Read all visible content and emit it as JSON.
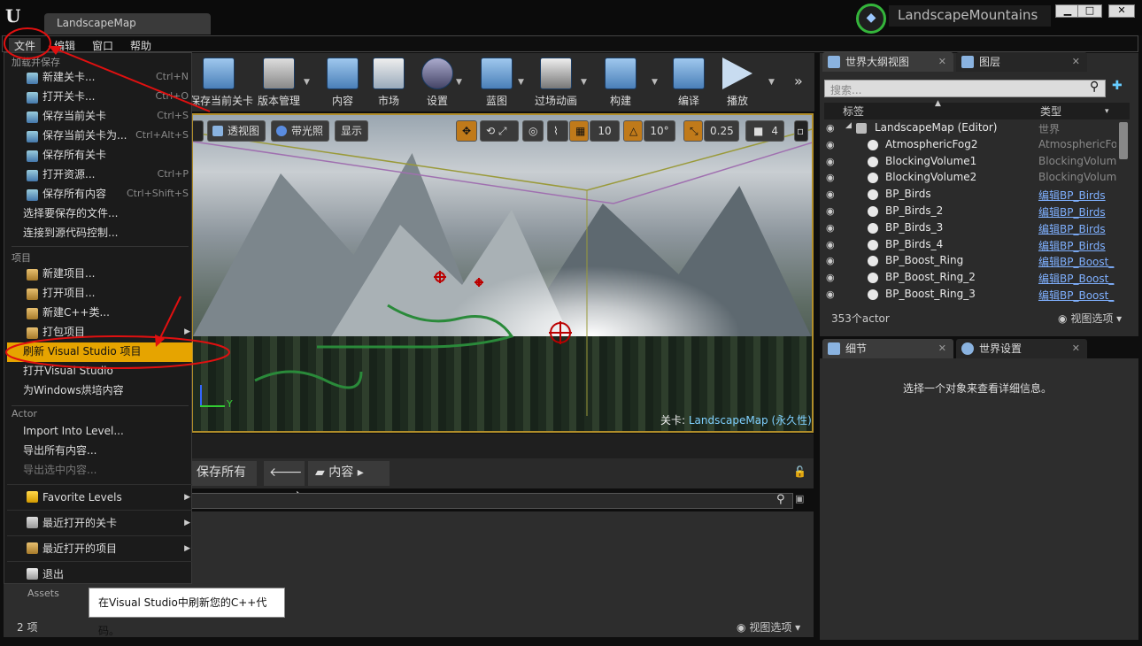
{
  "window": {
    "tab_title": "LandscapeMap",
    "project_name": "LandscapeMountains",
    "logo": "u-logo-icon",
    "minimize": "▁",
    "maximize": "□",
    "close": "✕"
  },
  "menubar": [
    "文件",
    "编辑",
    "窗口",
    "帮助"
  ],
  "toolbar": [
    {
      "label": "保存当前关卡",
      "icon": "save-icon"
    },
    {
      "label": "版本管理",
      "icon": "source-control-icon"
    },
    {
      "label": "内容",
      "icon": "content-icon"
    },
    {
      "label": "市场",
      "icon": "marketplace-icon"
    },
    {
      "label": "设置",
      "icon": "settings-icon"
    },
    {
      "label": "蓝图",
      "icon": "blueprint-icon"
    },
    {
      "label": "过场动画",
      "icon": "cinematics-icon"
    },
    {
      "label": "构建",
      "icon": "build-icon"
    },
    {
      "label": "编译",
      "icon": "compile-icon"
    },
    {
      "label": "播放",
      "icon": "play-icon"
    }
  ],
  "viewport": {
    "perspective": "透视图",
    "lit": "带光照",
    "show": "显示",
    "grid_snap": "10",
    "rotation_snap": "10°",
    "scale_snap": "0.25",
    "camera_speed": "4",
    "level_prefix": "关卡:",
    "level_name": "LandscapeMap (永久性)",
    "axis_label": "Y"
  },
  "content_browser": {
    "save_all": "保存所有",
    "path": "内容",
    "folder": "Assets",
    "item_count": "2 项",
    "view_options": "视图选项"
  },
  "world_outliner": {
    "tab": "世界大纲视图",
    "layers_tab": "图层",
    "search_placeholder": "搜索...",
    "col_label": "标签",
    "col_type": "类型",
    "rows": [
      {
        "label": "LandscapeMap (Editor)",
        "type": "世界",
        "link": false,
        "indent": 0
      },
      {
        "label": "AtmosphericFog2",
        "type": "AtmosphericFog",
        "link": false,
        "indent": 1
      },
      {
        "label": "BlockingVolume1",
        "type": "BlockingVolume",
        "link": false,
        "indent": 1
      },
      {
        "label": "BlockingVolume2",
        "type": "BlockingVolume",
        "link": false,
        "indent": 1
      },
      {
        "label": "BP_Birds",
        "type": "编辑BP_Birds",
        "link": true,
        "indent": 1
      },
      {
        "label": "BP_Birds_2",
        "type": "编辑BP_Birds",
        "link": true,
        "indent": 1
      },
      {
        "label": "BP_Birds_3",
        "type": "编辑BP_Birds",
        "link": true,
        "indent": 1
      },
      {
        "label": "BP_Birds_4",
        "type": "编辑BP_Birds",
        "link": true,
        "indent": 1
      },
      {
        "label": "BP_Boost_Ring",
        "type": "编辑BP_Boost_",
        "link": true,
        "indent": 1
      },
      {
        "label": "BP_Boost_Ring_2",
        "type": "编辑BP_Boost_",
        "link": true,
        "indent": 1
      },
      {
        "label": "BP_Boost_Ring_3",
        "type": "编辑BP_Boost_",
        "link": true,
        "indent": 1
      }
    ],
    "actor_count": "353个actor",
    "view_options": "视图选项"
  },
  "details": {
    "tab": "细节",
    "world_settings_tab": "世界设置",
    "empty_message": "选择一个对象来查看详细信息。"
  },
  "file_menu": {
    "sections": [
      "加载并保存",
      "项目",
      "Actor"
    ],
    "load_save": [
      {
        "label": "新建关卡...",
        "shortcut": "Ctrl+N",
        "icon": true
      },
      {
        "label": "打开关卡...",
        "shortcut": "Ctrl+O",
        "icon": true
      },
      {
        "label": "保存当前关卡",
        "shortcut": "Ctrl+S",
        "icon": true
      },
      {
        "label": "保存当前关卡为...",
        "shortcut": "Ctrl+Alt+S",
        "icon": true
      },
      {
        "label": "保存所有关卡",
        "shortcut": "",
        "icon": true
      },
      {
        "label": "打开资源...",
        "shortcut": "Ctrl+P",
        "icon": true
      },
      {
        "label": "保存所有内容",
        "shortcut": "Ctrl+Shift+S",
        "icon": true
      },
      {
        "label": "选择要保存的文件...",
        "shortcut": "",
        "icon": false
      },
      {
        "label": "连接到源代码控制...",
        "shortcut": "",
        "icon": false
      }
    ],
    "project": [
      {
        "label": "新建项目...",
        "icon": true,
        "submenu": false,
        "highlight": false
      },
      {
        "label": "打开项目...",
        "icon": true,
        "submenu": false,
        "highlight": false
      },
      {
        "label": "新建C++类...",
        "icon": true,
        "submenu": false,
        "highlight": false
      },
      {
        "label": "打包项目",
        "icon": true,
        "submenu": true,
        "highlight": false
      },
      {
        "label": "刷新 Visual Studio 项目",
        "icon": false,
        "submenu": false,
        "highlight": true
      },
      {
        "label": "打开Visual Studio",
        "icon": false,
        "submenu": false,
        "highlight": false
      },
      {
        "label": "为Windows烘培内容",
        "icon": false,
        "submenu": false,
        "highlight": false
      }
    ],
    "actor": [
      {
        "label": "Import Into Level...",
        "disabled": false
      },
      {
        "label": "导出所有内容...",
        "disabled": false
      },
      {
        "label": "导出选中内容...",
        "disabled": true
      }
    ],
    "extra": [
      {
        "label": "Favorite Levels",
        "icon": "star-icon"
      },
      {
        "label": "最近打开的关卡",
        "icon": "recent-levels-icon"
      },
      {
        "label": "最近打开的项目",
        "icon": "recent-projects-icon"
      },
      {
        "label": "退出",
        "icon": "exit-icon"
      }
    ]
  },
  "tooltip": "在Visual Studio中刷新您的C++代码。",
  "colors": {
    "highlight": "#e6a400",
    "annotation": "#e01010",
    "viewport_border": "#b08d2a",
    "link": "#7fb0ff"
  }
}
